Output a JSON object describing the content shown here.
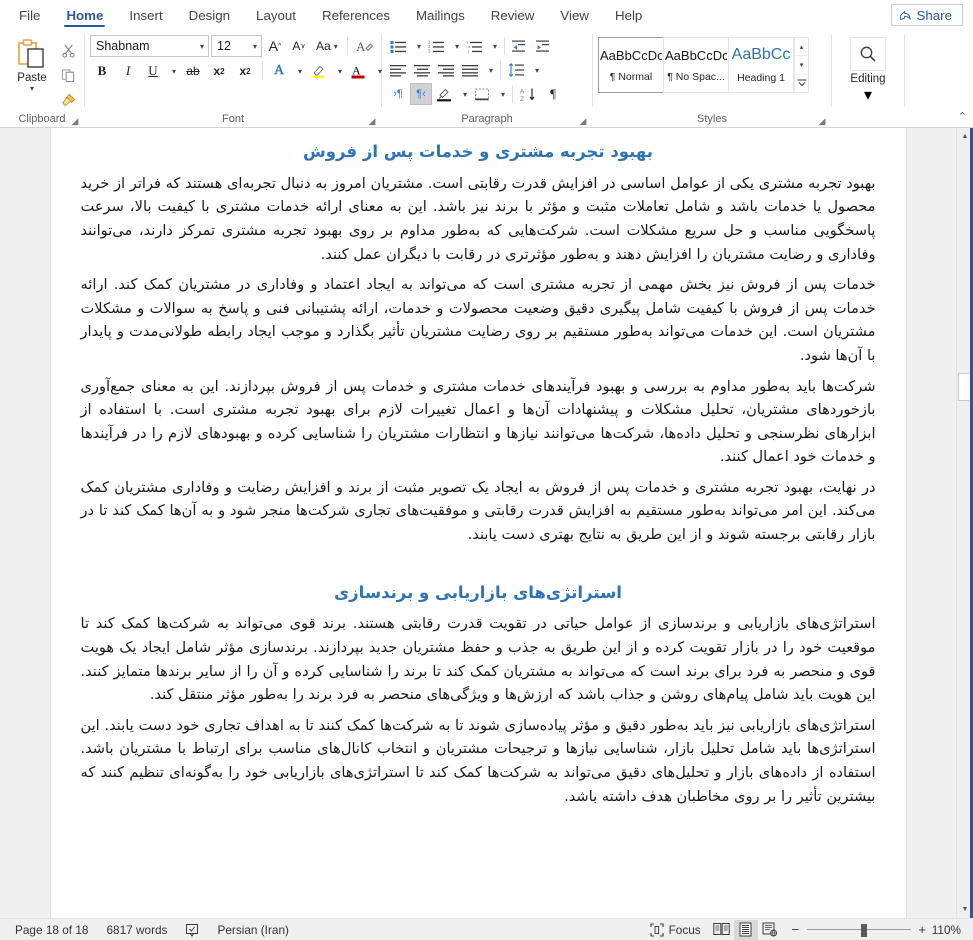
{
  "window": {
    "tabs": [
      {
        "label": "File",
        "active": false
      },
      {
        "label": "Home",
        "active": true
      },
      {
        "label": "Insert",
        "active": false
      },
      {
        "label": "Design",
        "active": false
      },
      {
        "label": "Layout",
        "active": false
      },
      {
        "label": "References",
        "active": false
      },
      {
        "label": "Mailings",
        "active": false
      },
      {
        "label": "Review",
        "active": false
      },
      {
        "label": "View",
        "active": false
      },
      {
        "label": "Help",
        "active": false
      }
    ],
    "share_label": "Share",
    "accent_color": "#2b579a"
  },
  "ribbon": {
    "clipboard": {
      "group_label": "Clipboard",
      "paste_label": "Paste",
      "cut_name": "cut-icon",
      "copy_name": "copy-icon",
      "format_painter_name": "format-painter-icon"
    },
    "font": {
      "group_label": "Font",
      "font_name": "Shabnam",
      "font_size": "12",
      "grow_label": "A",
      "shrink_label": "A",
      "change_case_label": "Aa",
      "clear_formatting_label": "A",
      "bold_label": "B",
      "italic_label": "I",
      "underline_label": "U",
      "strikethrough_label": "ab",
      "subscript_label": "x",
      "subscript_sub": "2",
      "superscript_label": "x",
      "superscript_sup": "2",
      "text_effects_label": "A",
      "highlight_label": "",
      "font_color_label": "A",
      "font_color": "#c00000",
      "highlight_color": "#ffff00"
    },
    "paragraph": {
      "group_label": "Paragraph",
      "bullets_name": "bullets-icon",
      "numbering_name": "numbering-icon",
      "multilevel_name": "multilevel-list-icon",
      "decrease_indent_name": "decrease-indent-icon",
      "increase_indent_name": "increase-indent-icon",
      "align_left_name": "align-left-icon",
      "align_center_name": "align-center-icon",
      "align_right_name": "align-right-icon",
      "justify_name": "justify-icon",
      "line_spacing_name": "line-spacing-icon",
      "ltr_label": "›¶",
      "rtl_label": "¶‹",
      "rtl_active": true,
      "shading_name": "shading-icon",
      "borders_name": "borders-icon",
      "sort_label": "A\nZ",
      "show_marks_label": "¶"
    },
    "styles": {
      "group_label": "Styles",
      "items": [
        {
          "sample": "AaBbCcDc",
          "name": "¶ Normal",
          "selected": true,
          "variant": "normal"
        },
        {
          "sample": "AaBbCcDc",
          "name": "¶ No Spac...",
          "selected": false,
          "variant": "normal"
        },
        {
          "sample": "AaBbCc",
          "name": "Heading 1",
          "selected": false,
          "variant": "h1"
        }
      ],
      "scroll_up": "▴",
      "scroll_down": "▾",
      "scroll_more": "≡"
    },
    "editing": {
      "group_label": "Editing",
      "label": "Editing",
      "icon": "search-icon"
    },
    "collapse_label": "⌃"
  },
  "document": {
    "sections": [
      {
        "heading": "بهبود تجربه مشتری و خدمات پس از فروش",
        "paragraphs": [
          "بهبود تجربه مشتری یکی از عوامل اساسی در افزایش قدرت رقابتی است. مشتریان امروز به دنبال تجربه‌ای هستند که فراتر از خرید محصول یا خدمات باشد و شامل تعاملات مثبت و مؤثر با برند نیز باشد. این به معنای ارائه خدمات مشتری با کیفیت بالا، سرعت پاسخگویی مناسب و حل سریع مشکلات است. شرکت‌هایی که به‌طور مداوم بر روی بهبود تجربه مشتری تمرکز دارند، می‌توانند وفاداری و رضایت مشتریان را افزایش دهند و به‌طور مؤثرتری در رقابت با دیگران عمل کنند.",
          "خدمات پس از فروش نیز بخش مهمی از تجربه مشتری است که می‌تواند به ایجاد اعتماد و وفاداری در مشتریان کمک کند. ارائه خدمات پس از فروش با کیفیت شامل پیگیری دقیق وضعیت محصولات و خدمات، ارائه پشتیبانی فنی و پاسخ به سوالات و مشکلات مشتریان است. این خدمات می‌تواند به‌طور مستقیم بر روی رضایت مشتریان تأثیر بگذارد و موجب ایجاد رابطه طولانی‌مدت و پایدار با آن‌ها شود.",
          "شرکت‌ها باید به‌طور مداوم به بررسی و بهبود فرآیندهای خدمات مشتری و خدمات پس از فروش بپردازند. این به معنای جمع‌آوری بازخوردهای مشتریان، تحلیل مشکلات و پیشنهادات آن‌ها و اعمال تغییرات لازم برای بهبود تجربه مشتری است. با استفاده از ابزارهای نظرسنجی و تحلیل داده‌ها، شرکت‌ها می‌توانند نیازها و انتظارات مشتریان را شناسایی کرده و بهبودهای لازم را در فرآیندها و خدمات خود اعمال کنند.",
          "در نهایت، بهبود تجربه مشتری و خدمات پس از فروش به ایجاد یک تصویر مثبت از برند و افزایش رضایت و وفاداری مشتریان کمک می‌کند. این امر می‌تواند به‌طور مستقیم به افزایش قدرت رقابتی و موفقیت‌های تجاری شرکت‌ها منجر شود و به آن‌ها کمک کند تا در بازار رقابتی برجسته شوند و از این طریق به نتایج بهتری دست یابند."
        ]
      },
      {
        "heading": "استراتژی‌های بازاریابی و برندسازی",
        "paragraphs": [
          "استراتژی‌های بازاریابی و برندسازی از عوامل حیاتی در تقویت قدرت رقابتی هستند. برند قوی می‌تواند به شرکت‌ها کمک کند تا موقعیت خود را در بازار تقویت کرده و از این طریق به جذب و حفظ مشتریان جدید بپردازند. برندسازی مؤثر شامل ایجاد یک هویت قوی و منحصر به فرد برای برند است که می‌تواند به مشتریان کمک کند تا برند را شناسایی کرده و آن را از سایر برندها متمایز کنند. این هویت باید شامل پیام‌های روشن و جذاب باشد که ارزش‌ها و ویژگی‌های منحصر به فرد برند را به‌طور مؤثر منتقل کند.",
          "استراتژی‌های بازاریابی نیز باید به‌طور دقیق و مؤثر پیاده‌سازی شوند تا به شرکت‌ها کمک کنند تا به اهداف تجاری خود دست یابند. این استراتژی‌ها باید شامل تحلیل بازار، شناسایی نیازها و ترجیحات مشتریان و انتخاب کانال‌های مناسب برای ارتباط با مشتریان باشد. استفاده از داده‌های بازار و تحلیل‌های دقیق می‌تواند به شرکت‌ها کمک کند تا استراتژی‌های بازاریابی خود را به‌گونه‌ای تنظیم کنند که بیشترین تأثیر را بر روی مخاطبان هدف داشته باشد."
        ]
      }
    ]
  },
  "statusbar": {
    "page": "Page 18 of 18",
    "words": "6817 words",
    "proofing_icon": "proofing-errors-icon",
    "language": "Persian (Iran)",
    "focus_label": "Focus",
    "read_mode_name": "read-mode-icon",
    "print_layout_name": "print-layout-icon",
    "web_layout_name": "web-layout-icon",
    "zoom_out": "−",
    "zoom_in": "+",
    "zoom_value": "110%"
  }
}
